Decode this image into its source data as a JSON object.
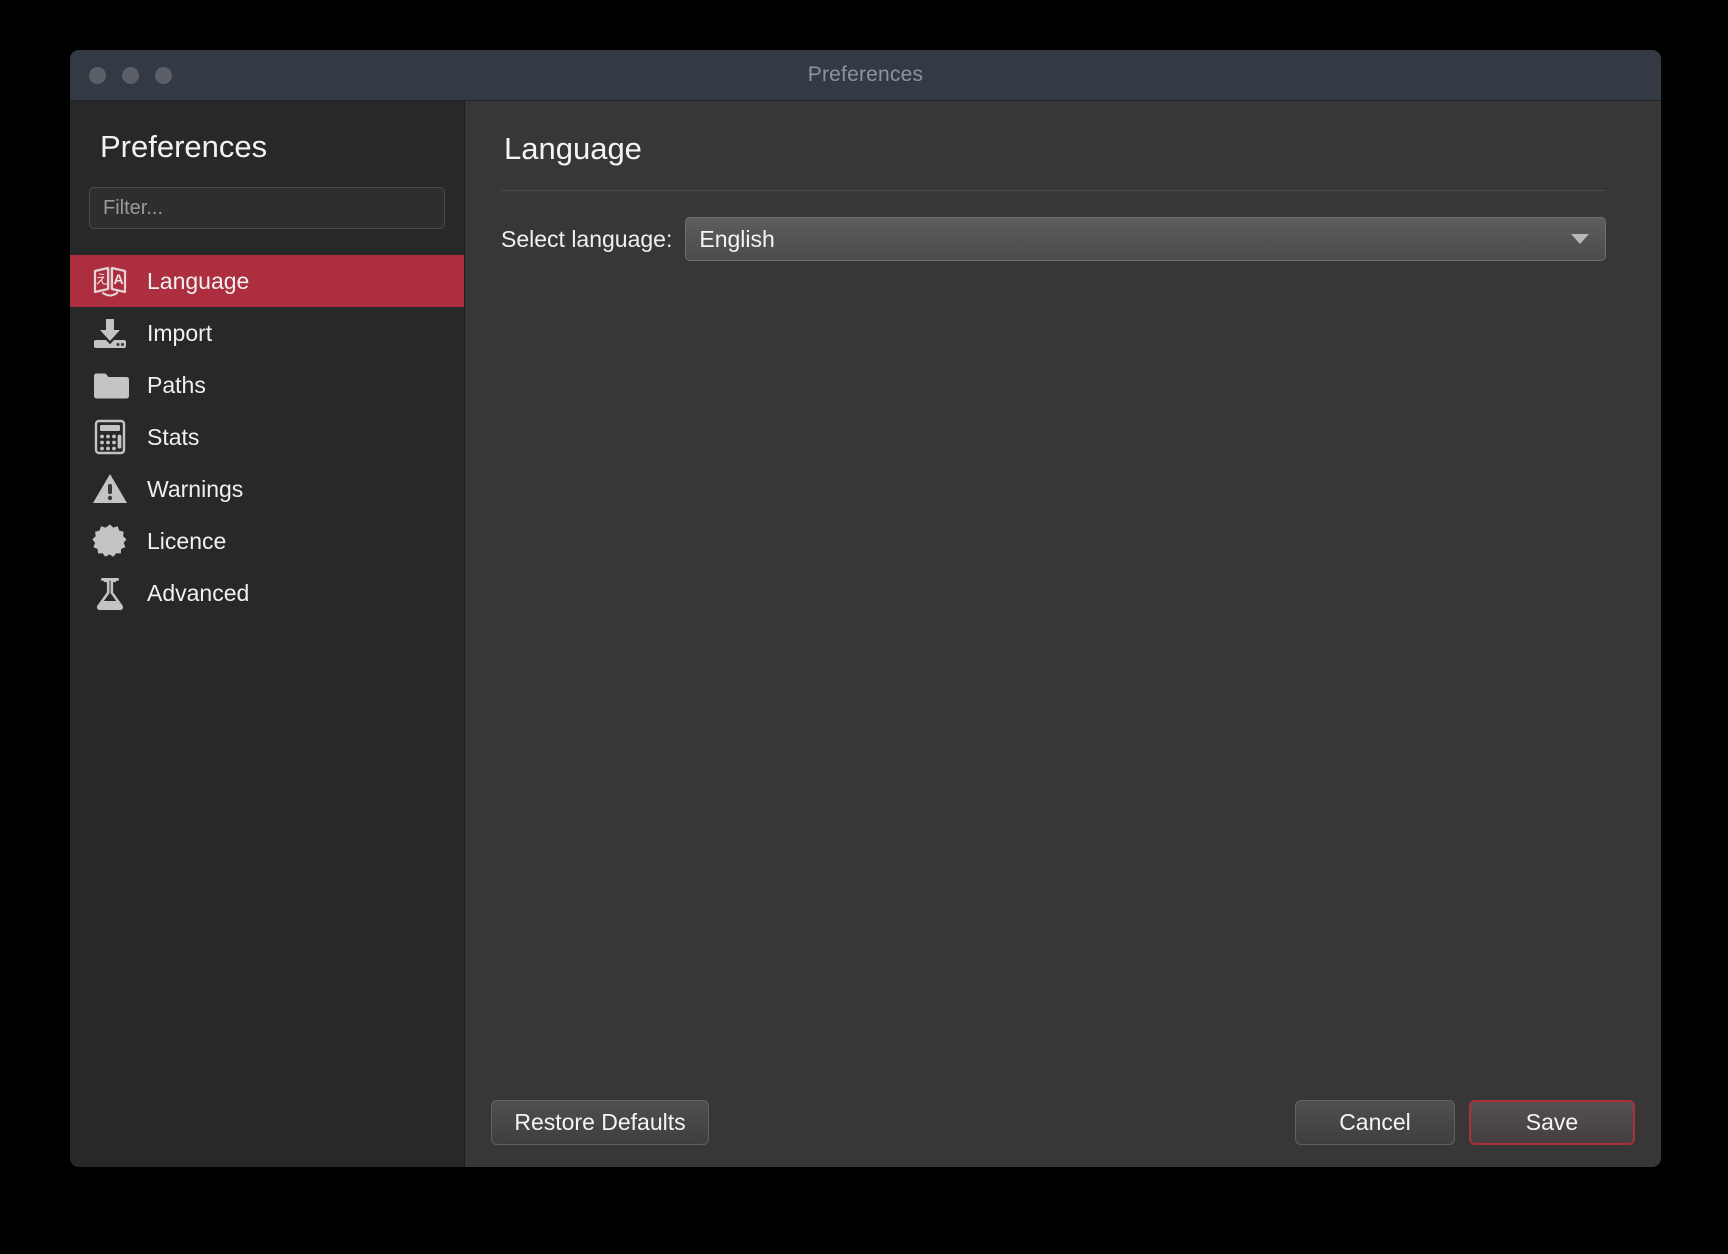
{
  "window": {
    "title": "Preferences",
    "traffic_lights": [
      "close-inactive",
      "minimize-inactive",
      "zoom-inactive"
    ]
  },
  "sidebar": {
    "heading": "Preferences",
    "filter": {
      "placeholder": "Filter...",
      "value": ""
    },
    "items": [
      {
        "label": "Language",
        "icon": "translate-icon",
        "selected": true
      },
      {
        "label": "Import",
        "icon": "download-tray-icon",
        "selected": false
      },
      {
        "label": "Paths",
        "icon": "folder-icon",
        "selected": false
      },
      {
        "label": "Stats",
        "icon": "calculator-icon",
        "selected": false
      },
      {
        "label": "Warnings",
        "icon": "warning-triangle-icon",
        "selected": false
      },
      {
        "label": "Licence",
        "icon": "seal-badge-icon",
        "selected": false
      },
      {
        "label": "Advanced",
        "icon": "flask-icon",
        "selected": false
      }
    ]
  },
  "content": {
    "page_title": "Language",
    "field_label": "Select language:",
    "language_select": {
      "value": "English",
      "arrow": "chevron-down-icon"
    }
  },
  "footer": {
    "restore_defaults_label": "Restore Defaults",
    "cancel_label": "Cancel",
    "save_label": "Save"
  },
  "colors": {
    "selection_red": "#ad2e3f",
    "titlebar": "#343a43",
    "sidebar_bg": "#282828",
    "content_bg": "#373737",
    "text_primary": "#f2f2f2",
    "text_muted": "#8d939c"
  }
}
